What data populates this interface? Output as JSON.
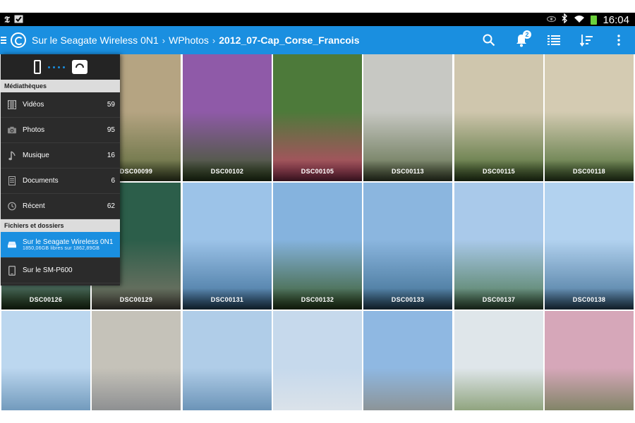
{
  "status_bar": {
    "left_icons": [
      "nyt-icon",
      "checklist-icon"
    ],
    "right_icons": [
      "eye-icon",
      "bluetooth-icon",
      "wifi-icon",
      "battery-icon"
    ],
    "time": "16:04"
  },
  "action_bar": {
    "breadcrumb": [
      {
        "label": "Sur le Seagate Wireless 0N1"
      },
      {
        "label": "WPhotos"
      },
      {
        "label": "2012_07-Cap_Corse_Francois"
      }
    ],
    "notification_count": "2",
    "accent_color": "#1a8fe0"
  },
  "drawer": {
    "media_section_title": "Médiathèques",
    "media_items": [
      {
        "icon": "film-icon",
        "label": "Vidéos",
        "count": "59"
      },
      {
        "icon": "camera-icon",
        "label": "Photos",
        "count": "95"
      },
      {
        "icon": "music-note-icon",
        "label": "Musique",
        "count": "16"
      },
      {
        "icon": "document-icon",
        "label": "Documents",
        "count": "6"
      },
      {
        "icon": "clock-icon",
        "label": "Récent",
        "count": "62"
      }
    ],
    "files_section_title": "Fichiers et dossiers",
    "locations": [
      {
        "icon": "drive-icon",
        "label": "Sur le Seagate Wireless 0N1",
        "detail": "1850,06GB libres sur 1862,89GB",
        "selected": true
      },
      {
        "icon": "tablet-icon",
        "label": "Sur le SM-P600",
        "detail": "",
        "selected": false
      }
    ]
  },
  "photos": [
    {
      "name": "",
      "palette": [
        "#c9b58f",
        "#6e7a4a"
      ]
    },
    {
      "name": "DSC00099",
      "palette": [
        "#b5a482",
        "#5d6b3c"
      ]
    },
    {
      "name": "DSC00102",
      "palette": [
        "#8f5aa8",
        "#3f5a2a"
      ]
    },
    {
      "name": "DSC00105",
      "palette": [
        "#4d7a3a",
        "#c4466a"
      ]
    },
    {
      "name": "DSC00113",
      "palette": [
        "#c7c8c3",
        "#5f6e4a"
      ]
    },
    {
      "name": "DSC00115",
      "palette": [
        "#cfc6ad",
        "#4a6a30"
      ]
    },
    {
      "name": "DSC00118",
      "palette": [
        "#d4cbb2",
        "#4d6e35"
      ]
    },
    {
      "name": "DSC00126",
      "palette": [
        "#6e8fb8",
        "#33512a"
      ]
    },
    {
      "name": "DSC00129",
      "palette": [
        "#2c5e4a",
        "#7a7566"
      ]
    },
    {
      "name": "DSC00131",
      "palette": [
        "#9cc3e8",
        "#3e6f99"
      ]
    },
    {
      "name": "DSC00132",
      "palette": [
        "#85b3de",
        "#3b5c2c"
      ]
    },
    {
      "name": "DSC00133",
      "palette": [
        "#8bb6df",
        "#3d6d90"
      ]
    },
    {
      "name": "DSC00137",
      "palette": [
        "#a9c9ea",
        "#4f7a55"
      ]
    },
    {
      "name": "DSC00138",
      "palette": [
        "#b2d2ef",
        "#46749a"
      ]
    },
    {
      "name": "",
      "palette": [
        "#bcd7ef",
        "#42739c"
      ]
    },
    {
      "name": "",
      "palette": [
        "#c5c2b9",
        "#6a6f78"
      ]
    },
    {
      "name": "",
      "palette": [
        "#b0cde8",
        "#3f6f98"
      ]
    },
    {
      "name": "",
      "palette": [
        "#c6d9ec",
        "#e8e8e8"
      ]
    },
    {
      "name": "",
      "palette": [
        "#8fb8e2",
        "#8a7d68"
      ]
    },
    {
      "name": "",
      "palette": [
        "#dfe6ea",
        "#5d7a3a"
      ]
    },
    {
      "name": "",
      "palette": [
        "#d6a7b9",
        "#4b6e33"
      ]
    }
  ]
}
